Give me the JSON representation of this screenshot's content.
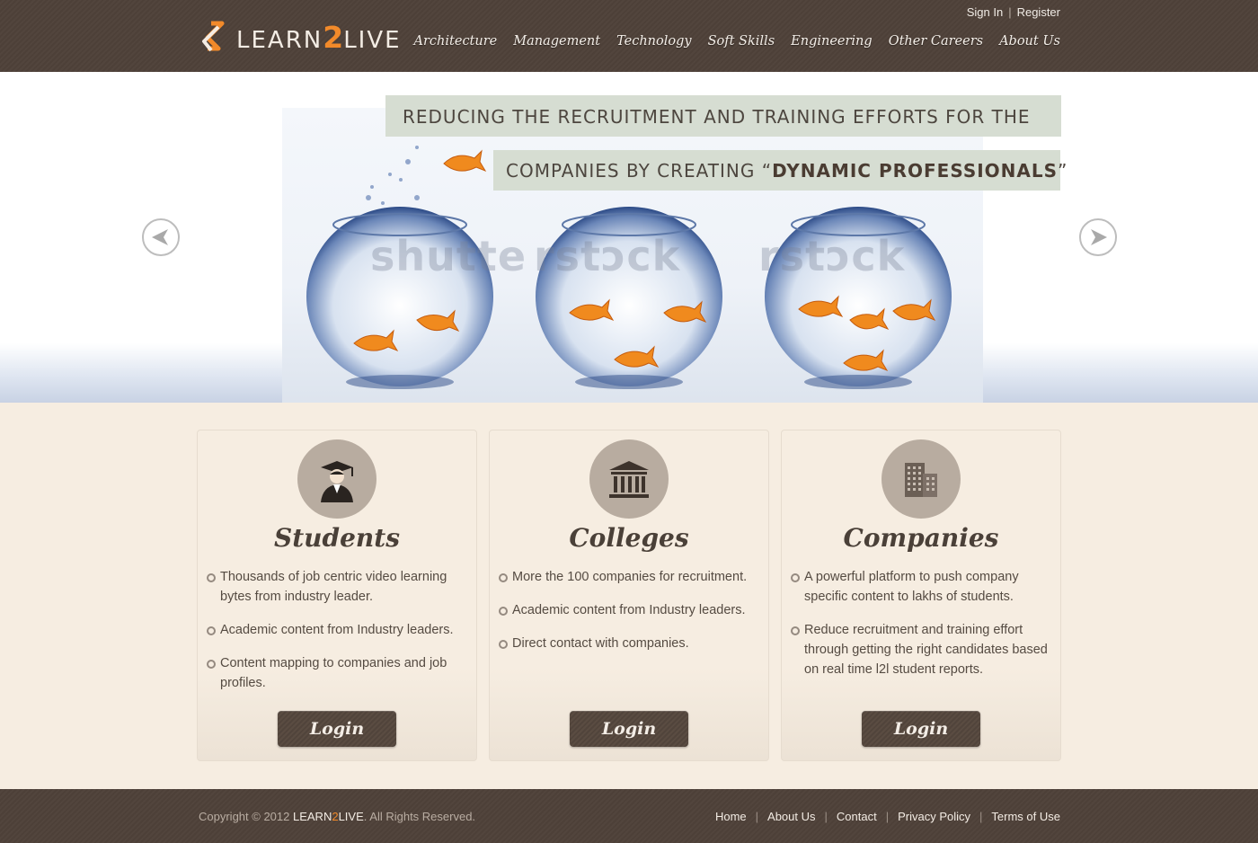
{
  "header": {
    "logo": {
      "part1": "LEARN",
      "part2": "2",
      "part3": "LIVE"
    },
    "top_links": {
      "sign_in": "Sign In",
      "separator": "|",
      "register": "Register"
    },
    "nav": [
      "Architecture",
      "Management",
      "Technology",
      "Soft Skills",
      "Engineering",
      "Other Careers",
      "About Us"
    ]
  },
  "hero": {
    "line1": "REDUCING THE RECRUITMENT AND TRAINING EFFORTS FOR THE",
    "line2_prefix": "COMPANIES BY CREATING “",
    "line2_bold": "DYNAMIC PROFESSIONALS",
    "line2_suffix": "”",
    "watermark_1": "shutte",
    "watermark_2": "rstɔck",
    "watermark_3": "rstɔck",
    "prev_icon": "chevron-left-icon",
    "next_icon": "chevron-right-icon"
  },
  "cards": [
    {
      "icon": "graduate-icon",
      "title": "Students",
      "items": [
        "Thousands of job centric video learning bytes from industry leader.",
        "Academic content from Industry leaders.",
        "Content mapping to companies and job profiles."
      ],
      "button": "Login"
    },
    {
      "icon": "college-building-icon",
      "title": "Colleges",
      "items": [
        "More the 100 companies for recruitment.",
        "Academic content from Industry leaders.",
        "Direct contact with companies."
      ],
      "button": "Login"
    },
    {
      "icon": "office-buildings-icon",
      "title": "Companies",
      "items": [
        "A powerful platform to push company specific content to lakhs of students.",
        "Reduce recruitment and training effort through getting the right candidates based on real time l2l student reports."
      ],
      "button": "Login"
    }
  ],
  "footer": {
    "copyright_prefix": "Copyright © 2012 ",
    "brand_part1": "LEARN",
    "brand_part2": "2",
    "brand_part3": "LIVE",
    "copyright_suffix": ". All Rights Reserved.",
    "links": [
      "Home",
      "About Us",
      "Contact",
      "Privacy Policy",
      "Terms of Use"
    ],
    "separator": "|"
  },
  "colors": {
    "header_bg": "#4d4038",
    "accent": "#f28a2a",
    "page_bg": "#f6ede1",
    "banner_bg": "#d6ddd2",
    "button_bg": "#5a4c42"
  }
}
